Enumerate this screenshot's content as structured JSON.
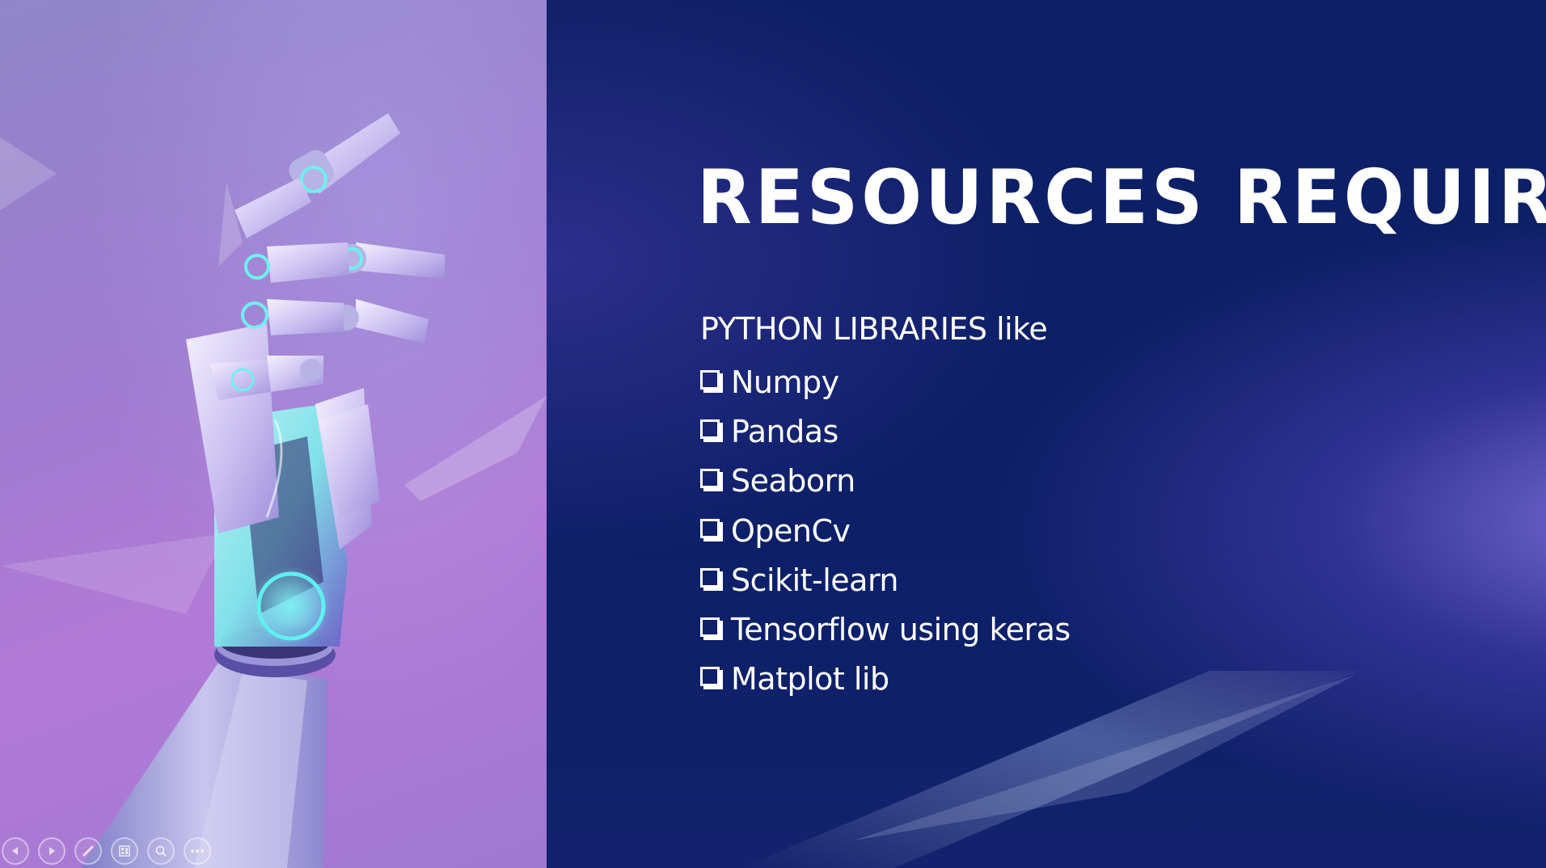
{
  "slide": {
    "title": "RESOURCES REQUIRED",
    "intro": "PYTHON LIBRARIES like",
    "libraries": [
      {
        "label": "Numpy"
      },
      {
        "label": "Pandas"
      },
      {
        "label": "Seaborn"
      },
      {
        "label": "OpenCv"
      },
      {
        "label": "Scikit-learn"
      },
      {
        "label": "Tensorflow using keras"
      },
      {
        "label": "Matplot lib"
      }
    ]
  },
  "toolbar": {
    "buttons": [
      {
        "icon": "previous-slide-icon"
      },
      {
        "icon": "next-slide-icon"
      },
      {
        "icon": "pen-icon"
      },
      {
        "icon": "slides-grid-icon"
      },
      {
        "icon": "zoom-icon"
      },
      {
        "icon": "more-options-icon"
      }
    ]
  },
  "colors": {
    "slide_background": "#0e1f66",
    "text": "#ffffff",
    "hero_purple": "#a07ad0",
    "hand_glow": "#5ff0f0"
  }
}
